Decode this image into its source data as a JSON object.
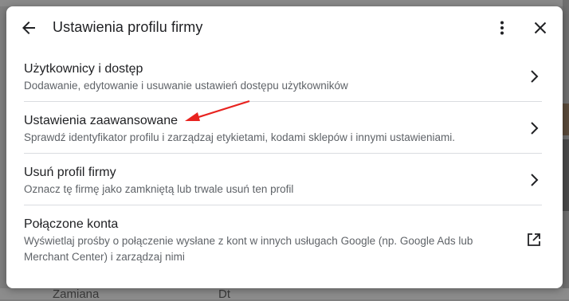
{
  "header": {
    "title": "Ustawienia profilu firmy"
  },
  "items": [
    {
      "label": "Użytkownicy i dostęp",
      "description": "Dodawanie, edytowanie i usuwanie ustawień dostępu użytkowników",
      "icon": "chevron-right-icon"
    },
    {
      "label": "Ustawienia zaawansowane",
      "description": "Sprawdź identyfikator profilu i zarządzaj etykietami, kodami sklepów i innymi ustawieniami.",
      "icon": "chevron-right-icon"
    },
    {
      "label": "Usuń profil firmy",
      "description": "Oznacz tę firmę jako zamkniętą lub trwale usuń ten profil",
      "icon": "chevron-right-icon"
    },
    {
      "label": "Połączone konta",
      "description_line1": "Wyświetlaj prośby o połączenie wysłane z kont w innych usługach Google (np. Google Ads lub",
      "description_line2": "Merchant Center) i zarządzaj nimi",
      "icon": "open-in-new-icon"
    }
  ],
  "background": {
    "bottom_left_text": "Zamiana",
    "bottom_mid_text": "Dt"
  },
  "colors": {
    "annotation_arrow": "#e8231f",
    "overlay": "#7f7f7f"
  }
}
